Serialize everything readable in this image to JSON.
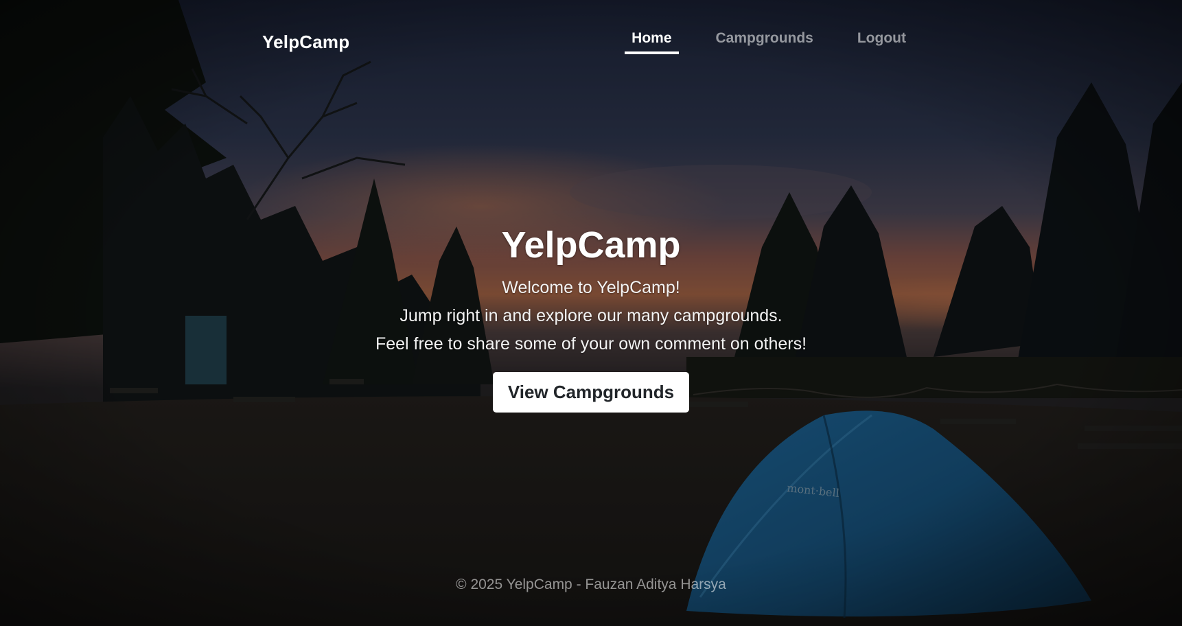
{
  "nav": {
    "brand": "YelpCamp",
    "links": [
      {
        "label": "Home",
        "active": true
      },
      {
        "label": "Campgrounds",
        "active": false
      },
      {
        "label": "Logout",
        "active": false
      }
    ]
  },
  "hero": {
    "title": "YelpCamp",
    "lines": [
      "Welcome to YelpCamp!",
      "Jump right in and explore our many campgrounds.",
      "Feel free to share some of your own comment on others!"
    ],
    "cta_label": "View Campgrounds"
  },
  "footer": {
    "text": "© 2025 YelpCamp - Fauzan Aditya Harsya"
  },
  "background": {
    "image": "dusk-campsite-with-blue-tent",
    "tent_brand": "mont-bell"
  },
  "colors": {
    "sky_top": "#1f2a44",
    "sunset": "#c8734e",
    "tent": "#1d5d8c",
    "ground": "#24211e",
    "button_bg": "#ffffff",
    "button_text": "#212529",
    "nav_inactive": "#8c8c8c"
  }
}
